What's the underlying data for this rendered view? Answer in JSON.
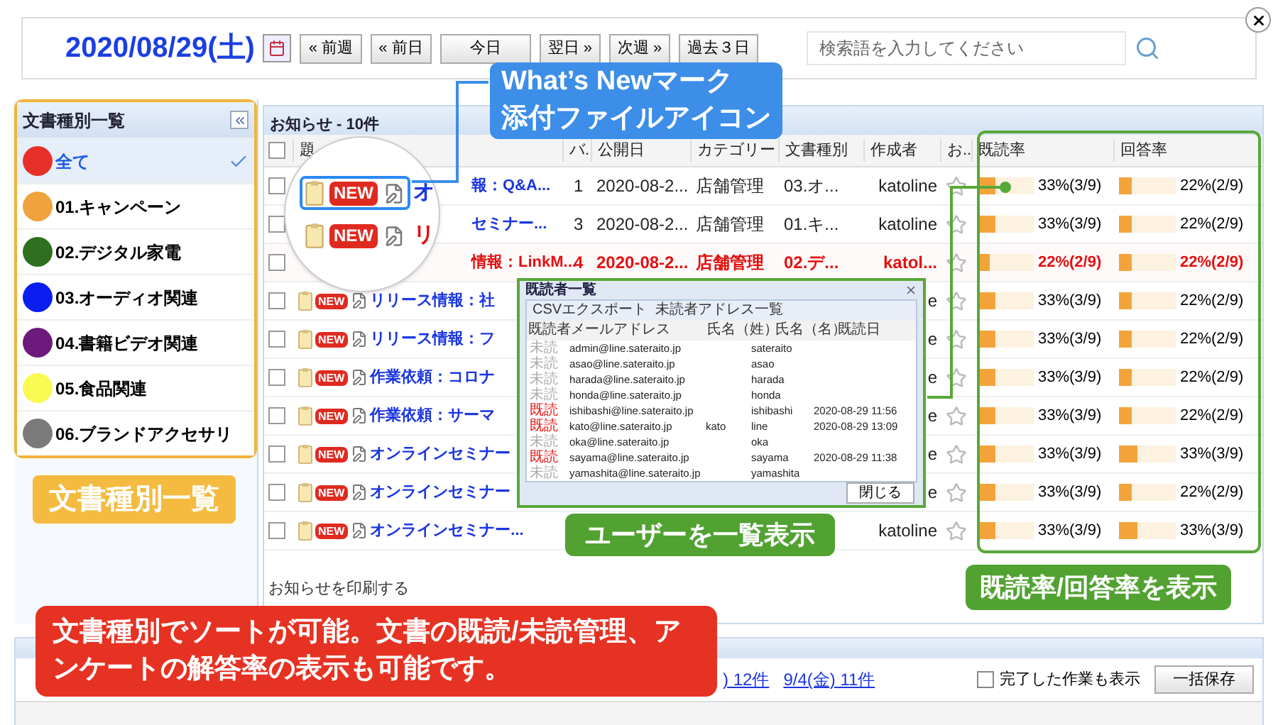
{
  "header": {
    "date": "2020/08/29(土)",
    "nav_buttons": [
      {
        "label": "« 前週",
        "wide": false
      },
      {
        "label": "« 前日",
        "wide": false
      },
      {
        "label": "今日",
        "wide": true
      },
      {
        "label": "翌日 »",
        "wide": false
      },
      {
        "label": "次週 »",
        "wide": false
      },
      {
        "label": "過去３日",
        "wide": false
      }
    ],
    "search": {
      "placeholder": "検索語を入力してください"
    }
  },
  "sidebar": {
    "title": "文書種別一覧",
    "items": [
      {
        "label": "全て",
        "color": "#e8302a",
        "selected": true
      },
      {
        "label": "01.キャンペーン",
        "color": "#f0a23c",
        "selected": false
      },
      {
        "label": "02.デジタル家電",
        "color": "#2e7020",
        "selected": false
      },
      {
        "label": "03.オーディオ関連",
        "color": "#0a1ef0",
        "selected": false
      },
      {
        "label": "04.書籍ビデオ関連",
        "color": "#6c1a7c",
        "selected": false
      },
      {
        "label": "05.食品関連",
        "color": "#fafa50",
        "selected": false
      },
      {
        "label": "06.ブランドアクセサリ",
        "color": "#7a7a7a",
        "selected": false
      }
    ]
  },
  "notices": {
    "title": "お知らせ - 10件",
    "select_all_checked": false,
    "columns": [
      "題",
      "バ..",
      "公開日",
      "カテゴリー",
      "文書種別",
      "作成者",
      "お..",
      "既読率",
      "回答率"
    ],
    "rows": [
      {
        "checked": false,
        "highlight": false,
        "badge": "",
        "title": "報：Q&A...",
        "version": "1",
        "date": "2020-08-2...",
        "category": "店舗管理",
        "doc_type": "03.オ...",
        "author": "katoline",
        "starred": false,
        "read": {
          "level": 0.33,
          "reading": "33%(3/9)"
        },
        "answer": {
          "level": 0.22,
          "reading": "22%(2/9)"
        }
      },
      {
        "checked": false,
        "highlight": false,
        "badge": "",
        "title": "セミナー...",
        "version": "3",
        "date": "2020-08-2...",
        "category": "店舗管理",
        "doc_type": "01.キ...",
        "author": "katoline",
        "starred": false,
        "read": {
          "level": 0.33,
          "reading": "33%(3/9)"
        },
        "answer": {
          "level": 0.22,
          "reading": "22%(2/9)"
        }
      },
      {
        "checked": false,
        "highlight": true,
        "badge": "",
        "title": "情報：LinkM...",
        "version": "4",
        "date": "2020-08-2...",
        "category": "店舗管理",
        "doc_type": "02.デ...",
        "author": "katol...",
        "starred": false,
        "read": {
          "level": 0.22,
          "reading": "22%(2/9)"
        },
        "answer": {
          "level": 0.22,
          "reading": "22%(2/9)"
        }
      },
      {
        "checked": false,
        "highlight": false,
        "badge": "NEW",
        "title": "リリース情報：社",
        "author": "e",
        "starred": false,
        "read": {
          "level": 0.33,
          "reading": "33%(3/9)"
        },
        "answer": {
          "level": 0.22,
          "reading": "22%(2/9)"
        }
      },
      {
        "checked": false,
        "highlight": false,
        "badge": "NEW",
        "title": "リリース情報：フ",
        "author": "e",
        "starred": false,
        "read": {
          "level": 0.33,
          "reading": "33%(3/9)"
        },
        "answer": {
          "level": 0.22,
          "reading": "22%(2/9)"
        }
      },
      {
        "checked": false,
        "highlight": false,
        "badge": "NEW",
        "title": "作業依頼：コロナ",
        "author": "e",
        "starred": false,
        "read": {
          "level": 0.33,
          "reading": "33%(3/9)"
        },
        "answer": {
          "level": 0.22,
          "reading": "22%(2/9)"
        }
      },
      {
        "checked": false,
        "highlight": false,
        "badge": "NEW",
        "title": "作業依頼：サーマ",
        "author": "e",
        "starred": false,
        "read": {
          "level": 0.33,
          "reading": "33%(3/9)"
        },
        "answer": {
          "level": 0.22,
          "reading": "22%(2/9)"
        }
      },
      {
        "checked": false,
        "highlight": false,
        "badge": "NEW",
        "title": "オンラインセミナー",
        "author": "e",
        "starred": false,
        "read": {
          "level": 0.33,
          "reading": "33%(3/9)"
        },
        "answer": {
          "level": 0.33,
          "reading": "33%(3/9)"
        }
      },
      {
        "checked": false,
        "highlight": false,
        "badge": "NEW",
        "title": "オンラインセミナー",
        "author": "e",
        "starred": false,
        "read": {
          "level": 0.33,
          "reading": "33%(3/9)"
        },
        "answer": {
          "level": 0.22,
          "reading": "22%(2/9)"
        }
      },
      {
        "checked": false,
        "highlight": false,
        "badge": "NEW",
        "title": "オンラインセミナー...",
        "author": "katoline",
        "starred": false,
        "read": {
          "level": 0.33,
          "reading": "33%(3/9)"
        },
        "answer": {
          "level": 0.33,
          "reading": "33%(3/9)"
        }
      }
    ],
    "print_link": "お知らせを印刷する"
  },
  "magnifier": {
    "rows": [
      {
        "highlighted": true,
        "badge": "NEW",
        "text": "オ",
        "text_highlight": false
      },
      {
        "highlighted": false,
        "badge": "NEW",
        "text": "リ",
        "text_highlight": true
      }
    ]
  },
  "popup": {
    "title": "既読者一覧",
    "tools": [
      "CSVエクスポート",
      "未読者アドレス一覧"
    ],
    "columns": [
      "既読者",
      "メールアドレス",
      "氏名（姓）",
      "氏名（名）",
      "既読日"
    ],
    "rows": [
      {
        "read": false,
        "status": "未読",
        "email": "admin@line.sateraito.jp",
        "last": "",
        "first": "sateraito",
        "date": ""
      },
      {
        "read": false,
        "status": "未読",
        "email": "asao@line.sateraito.jp",
        "last": "",
        "first": "asao",
        "date": ""
      },
      {
        "read": false,
        "status": "未読",
        "email": "harada@line.sateraito.jp",
        "last": "",
        "first": "harada",
        "date": ""
      },
      {
        "read": false,
        "status": "未読",
        "email": "honda@line.sateraito.jp",
        "last": "",
        "first": "honda",
        "date": ""
      },
      {
        "read": true,
        "status": "既読",
        "email": "ishibashi@line.sateraito.jp",
        "last": "",
        "first": "ishibashi",
        "date": "2020-08-29 11:56"
      },
      {
        "read": true,
        "status": "既読",
        "email": "kato@line.sateraito.jp",
        "last": "kato",
        "first": "line",
        "date": "2020-08-29 13:09"
      },
      {
        "read": false,
        "status": "未読",
        "email": "oka@line.sateraito.jp",
        "last": "",
        "first": "oka",
        "date": ""
      },
      {
        "read": true,
        "status": "既読",
        "email": "sayama@line.sateraito.jp",
        "last": "",
        "first": "sayama",
        "date": "2020-08-29 11:38"
      },
      {
        "read": false,
        "status": "未読",
        "email": "yamashita@line.sateraito.jp",
        "last": "",
        "first": "yamashita",
        "date": ""
      }
    ],
    "close_button": "閉じる"
  },
  "tasks": {
    "links": [
      ") 12件",
      "9/4(金) 11件"
    ],
    "show_done": {
      "label": "完了した作業も表示",
      "checked": false
    },
    "save_button": "一括保存"
  },
  "callouts": {
    "whats_new": [
      "What’s Newマーク",
      "添付ファイルアイコン"
    ],
    "sidebar": "文書種別一覧",
    "users": "ユーザーを一覧表示",
    "rates": "既読率/回答率を表示",
    "summary": "文書種別でソートが可能。文書の既読/未読管理、アンケートの解答率の表示も可能です。"
  }
}
